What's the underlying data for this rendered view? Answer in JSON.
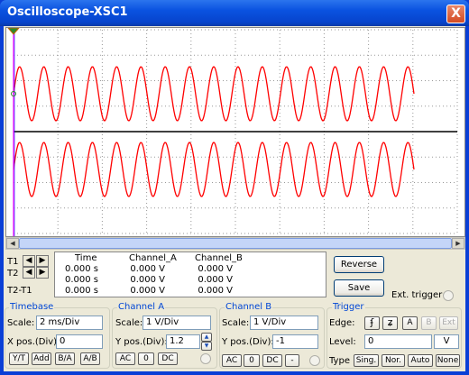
{
  "window": {
    "title": "Oscilloscope-XSC1",
    "close_glyph": "X"
  },
  "scope": {
    "background": "#ffffff",
    "grid_color": "#999999",
    "trace_color": "#ff0000",
    "axis_color": "#000000",
    "cursor1_color": "#ff00ff",
    "cursor2_color": "#0000ff"
  },
  "cursors": {
    "t1": "T1",
    "t2": "T2",
    "t2t1": "T2-T1",
    "left_arrow": "🡰",
    "right_arrow": "🡲"
  },
  "readout": {
    "headers": [
      "Time",
      "Channel_A",
      "Channel_B"
    ],
    "rows": [
      [
        "0.000 s",
        "0.000 V",
        "0.000 V"
      ],
      [
        "0.000 s",
        "0.000 V",
        "0.000 V"
      ],
      [
        "0.000 s",
        "0.000 V",
        "0.000 V"
      ]
    ]
  },
  "buttons": {
    "reverse": "Reverse",
    "save": "Save"
  },
  "ext_trigger": "Ext. trigger",
  "timebase": {
    "title": "Timebase",
    "scale_label": "Scale:",
    "scale_value": "2 ms/Div",
    "xpos_label": "X pos.(Div):",
    "xpos_value": "0",
    "modes": [
      "Y/T",
      "Add",
      "B/A",
      "A/B"
    ]
  },
  "channel_a": {
    "title": "Channel A",
    "scale_label": "Scale:",
    "scale_value": "1  V/Div",
    "ypos_label": "Y pos.(Div):",
    "ypos_value": "1.2",
    "coupling": [
      "AC",
      "0",
      "DC"
    ]
  },
  "channel_b": {
    "title": "Channel B",
    "scale_label": "Scale:",
    "scale_value": "1  V/Div",
    "ypos_label": "Y pos.(Div):",
    "ypos_value": "-1",
    "coupling": [
      "AC",
      "0",
      "DC",
      "-"
    ]
  },
  "trigger": {
    "title": "Trigger",
    "edge_label": "Edge:",
    "edge_rising": "ʄ",
    "edge_falling": "ʑ",
    "sources": [
      "A",
      "B",
      "Ext"
    ],
    "level_label": "Level:",
    "level_value": "0",
    "level_unit": "V",
    "type_label": "Type",
    "types": [
      "Sing.",
      "Nor.",
      "Auto",
      "None"
    ]
  }
}
